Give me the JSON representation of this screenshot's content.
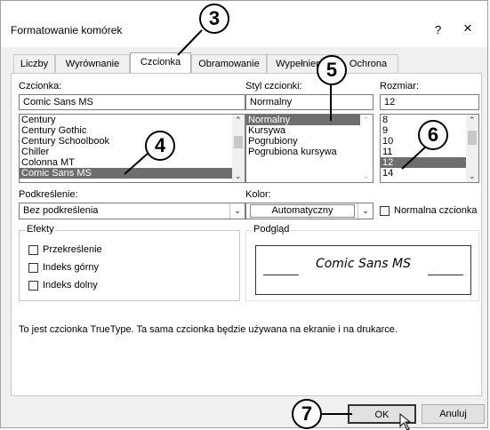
{
  "dialog": {
    "title": "Formatowanie komórek",
    "help": "?",
    "close": "×"
  },
  "tabs": [
    {
      "label": "Liczby"
    },
    {
      "label": "Wyrównanie"
    },
    {
      "label": "Czcionka"
    },
    {
      "label": "Obramowanie"
    },
    {
      "label": "Wypełnienie"
    },
    {
      "label": "Ochrona"
    }
  ],
  "font": {
    "label": "Czcionka:",
    "value": "Comic Sans MS",
    "items": [
      "Century",
      "Century Gothic",
      "Century Schoolbook",
      "Chiller",
      "Colonna MT",
      "Comic Sans MS"
    ]
  },
  "style": {
    "label": "Styl czcionki:",
    "value": "Normalny",
    "items": [
      "Normalny",
      "Kursywa",
      "Pogrubiony",
      "Pogrubiona kursywa"
    ]
  },
  "size": {
    "label": "Rozmiar:",
    "value": "12",
    "items": [
      "8",
      "9",
      "10",
      "11",
      "12",
      "14"
    ]
  },
  "underline": {
    "label": "Podkreślenie:",
    "value": "Bez podkreślenia"
  },
  "color": {
    "label": "Kolor:",
    "value": "Automatyczny"
  },
  "normal_font": {
    "label": "Normalna czcionka"
  },
  "effects": {
    "title": "Efekty",
    "strike": "Przekreślenie",
    "superscript": "Indeks górny",
    "subscript": "Indeks dolny"
  },
  "preview": {
    "title": "Podgląd",
    "text": "Comic Sans MS"
  },
  "info": "To jest czcionka TrueType. Ta sama czcionka będzie używana na ekranie i na drukarce.",
  "buttons": {
    "ok": "OK",
    "cancel": "Anuluj"
  },
  "callouts": [
    "3",
    "4",
    "5",
    "6",
    "7"
  ]
}
